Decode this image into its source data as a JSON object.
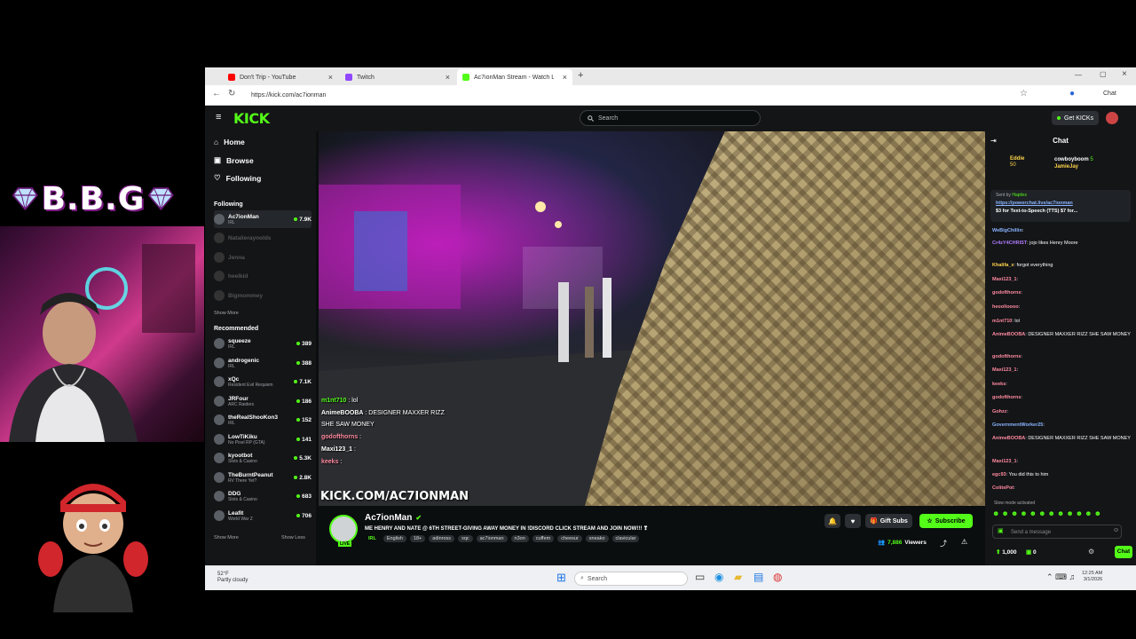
{
  "overlay": {
    "brand": "B.B.G"
  },
  "browser": {
    "tabs": [
      {
        "label": "Don't Trip - YouTube",
        "color": "#ff0000"
      },
      {
        "label": "Twitch",
        "color": "#9146ff"
      },
      {
        "label": "Ac7ionMan Stream - Watch L",
        "color": "#53fc18"
      }
    ],
    "url": "https://kick.com/ac7ionman",
    "chat_label": "Chat"
  },
  "kick": {
    "search_placeholder": "Search",
    "get_kicks": "Get KICKs",
    "nav": [
      "Home",
      "Browse",
      "Following"
    ],
    "following_header": "Following",
    "following": [
      {
        "name": "Ac7ionMan",
        "sub": "IRL",
        "viewers": "7.9K",
        "live": true
      },
      {
        "name": "Natalieraynolds",
        "sub": "",
        "viewers": "",
        "live": false
      },
      {
        "name": "Jenna",
        "sub": "",
        "viewers": "",
        "live": false
      },
      {
        "name": "heelkid",
        "sub": "",
        "viewers": "",
        "live": false
      },
      {
        "name": "Bigmommey",
        "sub": "",
        "viewers": "",
        "live": false
      }
    ],
    "show_more": "Show More",
    "show_less": "Show Less",
    "recommended_header": "Recommended",
    "recommended": [
      {
        "name": "squeeze",
        "sub": "IRL",
        "viewers": "389"
      },
      {
        "name": "androgenic",
        "sub": "IRL",
        "viewers": "388"
      },
      {
        "name": "xQc",
        "sub": "Resident Evil Requiem",
        "viewers": "7.1K"
      },
      {
        "name": "JRFour",
        "sub": "ARC Raiders",
        "viewers": "186"
      },
      {
        "name": "theRealShooKon3",
        "sub": "IRL",
        "viewers": "152"
      },
      {
        "name": "LowTiKiku",
        "sub": "No Pixel RP (GTA)",
        "viewers": "141"
      },
      {
        "name": "kyootbot",
        "sub": "Slots & Casino",
        "viewers": "5.3K"
      },
      {
        "name": "TheBurntPeanut",
        "sub": "RV There Yet?",
        "viewers": "2.8K"
      },
      {
        "name": "DDG",
        "sub": "Slots & Casino",
        "viewers": "683"
      },
      {
        "name": "Leafit",
        "sub": "World War Z",
        "viewers": "706"
      }
    ],
    "video_overlay": [
      {
        "user": "m1nt710",
        "text": " : lol"
      },
      {
        "user": "AnimeBOOBA",
        "text": " : DESIGNER MAXXER RIZZ"
      },
      {
        "user": "",
        "text": "SHE SAW MONEY"
      },
      {
        "user": "godofthorns",
        "text": " :"
      },
      {
        "user": "Maxi123_1",
        "text": " :"
      },
      {
        "user": "keeks",
        "text": " :"
      }
    ],
    "watermark": "KICK.COM/AC7IONMAN",
    "channel": {
      "name": "Ac7ionMan",
      "live": "LIVE",
      "title": "ME HENRY AND NATE @ 6TH STREET-GIVING AWAY MONEY IN !DISCORD CLICK STREAM AND JOIN NOW!!! ❣",
      "tags": [
        "IRL",
        "English",
        "18+",
        "adinross",
        "xqc",
        "ac7ionman",
        "n3on",
        "cuffem",
        "cheesur",
        "sneako",
        "clavicular"
      ],
      "gift_subs": "Gift Subs",
      "subscribe": "Subscribe",
      "viewers": "7,886",
      "viewers_label": "Viewers"
    },
    "chat": {
      "title": "Chat",
      "leaderboard": [
        {
          "user": "Eddie",
          "count": "50"
        },
        {
          "user": "cowboyboom",
          "count": "5"
        },
        {
          "user": "JamieJay",
          "count": ""
        }
      ],
      "pinned_sender": "Sent by",
      "pinned_from": "Haptixx",
      "pinned_link": "https://powerchat.live/ac7ionman",
      "pinned_text": "$3 for Text-to-Speech (TTS) $7 for...",
      "messages": [
        {
          "user": "WeBigChillin",
          "text": ":",
          "color": "#8ab4ff"
        },
        {
          "user": "Cr4zY4CHRIST",
          "text": ": jojo likes Henry Moore",
          "color": "#b07cff"
        },
        {
          "user": "Khalifa_x",
          "text": ": forgot everything",
          "color": "#ffd54a"
        },
        {
          "user": "Maxi123_1",
          "text": ":",
          "color": "#ff8aa0"
        },
        {
          "user": "godofthorns",
          "text": ":",
          "color": "#ff8aa0"
        },
        {
          "user": "heoolioooo",
          "text": ":",
          "color": "#ff8aa0"
        },
        {
          "user": "m1nt710",
          "text": ": lol",
          "color": "#ff8aa0"
        },
        {
          "user": "AnimeBOOBA",
          "text": ": DESIGNER MAXXER RIZZ SHE SAW MONEY",
          "color": "#ff8aa0"
        },
        {
          "user": "godofthorns",
          "text": ":",
          "color": "#ff8aa0"
        },
        {
          "user": "Maxi123_1",
          "text": ":",
          "color": "#ff8aa0"
        },
        {
          "user": "keeks",
          "text": ":",
          "color": "#ff8aa0"
        },
        {
          "user": "godofthorns",
          "text": ":",
          "color": "#ff8aa0"
        },
        {
          "user": "Gohzz",
          "text": ":",
          "color": "#ff8aa0"
        },
        {
          "user": "GovernmentWorker25",
          "text": ":",
          "color": "#8ab4ff"
        },
        {
          "user": "AnimeBOOBA",
          "text": ": DESIGNER MAXXER RIZZ SHE SAW MONEY",
          "color": "#ff8aa0"
        },
        {
          "user": "Maxi123_1",
          "text": ":",
          "color": "#ff8aa0"
        },
        {
          "user": "egc93",
          "text": ": You did this to him",
          "color": "#ff8aa0"
        },
        {
          "user": "ColitePot",
          "text": ":",
          "color": "#ff8aa0"
        }
      ],
      "slow_mode": "Slow mode activated",
      "input_placeholder": "Send a message",
      "points": "1,000",
      "zero": "0",
      "send": "Chat"
    }
  },
  "taskbar": {
    "weather_temp": "52°F",
    "weather_desc": "Partly cloudy",
    "search": "Search",
    "time": "12:25 AM",
    "date": "3/1/2026"
  },
  "colors": {
    "kick_green": "#53fc18",
    "bg": "#0b0e0f",
    "panel": "#141517"
  }
}
